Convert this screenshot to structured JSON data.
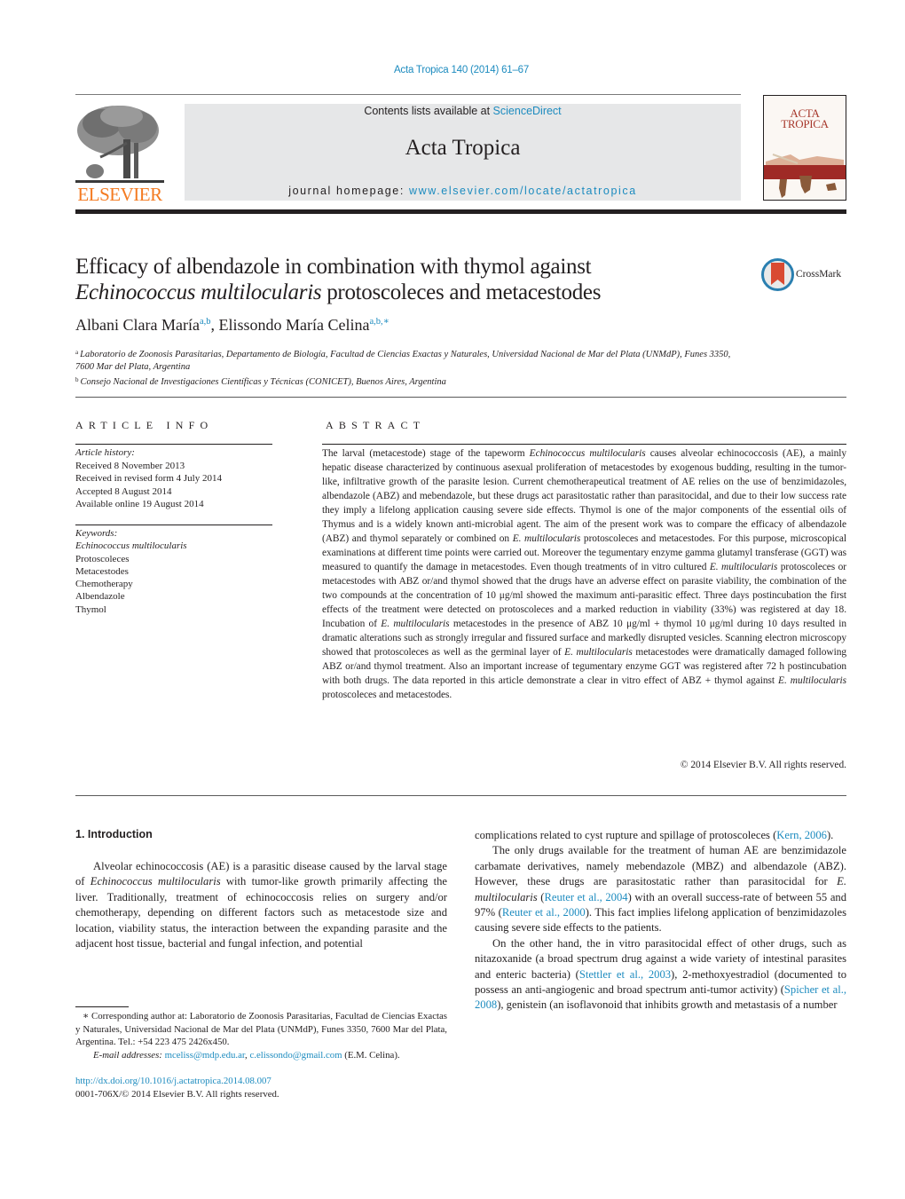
{
  "header": {
    "citation": "Acta Tropica 140 (2014) 61–67",
    "contents_prefix": "Contents lists available at ",
    "contents_link": "ScienceDirect",
    "journal_name": "Acta Tropica",
    "homepage_prefix": "journal homepage: ",
    "homepage_link": "www.elsevier.com/locate/actatropica",
    "publisher_logo_text": "ELSEVIER",
    "cover_title_line1": "ACTA",
    "cover_title_line2": "TROPICA",
    "crossmark_label": "CrossMark"
  },
  "article": {
    "title_line1": "Efficacy of albendazole in combination with thymol against",
    "title_line2_italic": "Echinococcus multilocularis",
    "title_line2_rest": " protoscoleces and metacestodes",
    "authors": [
      {
        "name": "Albani Clara María",
        "affil": "a,b"
      },
      {
        "name": "Elissondo María Celina",
        "affil": "a,b,∗"
      }
    ],
    "affiliations": [
      {
        "mark": "a",
        "text": "Laboratorio de Zoonosis Parasitarias, Departamento de Biología, Facultad de Ciencias Exactas y Naturales, Universidad Nacional de Mar del Plata (UNMdP), Funes 3350, 7600 Mar del Plata, Argentina"
      },
      {
        "mark": "b",
        "text": "Consejo Nacional de Investigaciones Científicas y Técnicas (CONICET), Buenos Aires, Argentina"
      }
    ]
  },
  "article_info": {
    "heading": "ARTICLE INFO",
    "history_label": "Article history:",
    "history": [
      "Received 8 November 2013",
      "Received in revised form 4 July 2014",
      "Accepted 8 August 2014",
      "Available online 19 August 2014"
    ],
    "keywords_label": "Keywords:",
    "keywords": [
      "Echinococcus multilocularis",
      "Protoscoleces",
      "Metacestodes",
      "Chemotherapy",
      "Albendazole",
      "Thymol"
    ]
  },
  "abstract": {
    "heading": "ABSTRACT",
    "segments": [
      {
        "t": "The larval (metacestode) stage of the tapeworm "
      },
      {
        "t": "Echinococcus multilocularis",
        "i": true
      },
      {
        "t": " causes alveolar echinococcosis (AE), a mainly hepatic disease characterized by continuous asexual proliferation of metacestodes by exogenous budding, resulting in the tumor-like, infiltrative growth of the parasite lesion. Current chemotherapeutical treatment of AE relies on the use of benzimidazoles, albendazole (ABZ) and mebendazole, but these drugs act parasitostatic rather than parasitocidal, and due to their low success rate they imply a lifelong application causing severe side effects. Thymol is one of the major components of the essential oils of Thymus and is a widely known anti-microbial agent. The aim of the present work was to compare the efficacy of albendazole (ABZ) and thymol separately or combined on "
      },
      {
        "t": "E. multilocularis",
        "i": true
      },
      {
        "t": " protoscoleces and metacestodes. For this purpose, microscopical examinations at different time points were carried out. Moreover the tegumentary enzyme gamma glutamyl transferase (GGT) was measured to quantify the damage in metacestodes. Even though treatments of in vitro cultured "
      },
      {
        "t": "E. multilocularis",
        "i": true
      },
      {
        "t": " protoscoleces or metacestodes with ABZ or/and thymol showed that the drugs have an adverse effect on parasite viability, the combination of the two compounds at the concentration of 10 μg/ml showed the maximum anti-parasitic effect. Three days postincubation the first effects of the treatment were detected on protoscoleces and a marked reduction in viability (33%) was registered at day 18. Incubation of "
      },
      {
        "t": "E. multilocularis",
        "i": true
      },
      {
        "t": " metacestodes in the presence of ABZ 10 μg/ml + thymol 10 μg/ml during 10 days resulted in dramatic alterations such as strongly irregular and fissured surface and markedly disrupted vesicles. Scanning electron microscopy showed that protoscoleces as well as the germinal layer of "
      },
      {
        "t": "E. multilocularis",
        "i": true
      },
      {
        "t": " metacestodes were dramatically damaged following ABZ or/and thymol treatment. Also an important increase of tegumentary enzyme GGT was registered after 72 h postincubation with both drugs. The data reported in this article demonstrate a clear in vitro effect of ABZ + thymol against "
      },
      {
        "t": "E. multilocularis",
        "i": true
      },
      {
        "t": " protoscoleces and metacestodes."
      }
    ],
    "copyright": "© 2014 Elsevier B.V. All rights reserved."
  },
  "body": {
    "section_title": "1.  Introduction",
    "left_paragraphs": [
      [
        {
          "t": "Alveolar echinococcosis (AE) is a parasitic disease caused by the larval stage of "
        },
        {
          "t": "Echinococcus multilocularis",
          "i": true
        },
        {
          "t": " with tumor-like growth primarily affecting the liver. Traditionally, treatment of echinococcosis relies on surgery and/or chemotherapy, depending on different factors such as metacestode size and location, viability status, the interaction between the expanding parasite and the adjacent host tissue, bacterial and fungal infection, and potential"
        }
      ]
    ],
    "right_paragraphs": [
      [
        {
          "t": "complications related to cyst rupture and spillage of protoscoleces ("
        },
        {
          "t": "Kern, 2006",
          "link": true
        },
        {
          "t": ")."
        }
      ],
      [
        {
          "t": "The only drugs available for the treatment of human AE are benzimidazole carbamate derivatives, namely mebendazole (MBZ) and albendazole (ABZ). However, these drugs are parasitostatic rather than parasitocidal for "
        },
        {
          "t": "E. multilocularis",
          "i": true
        },
        {
          "t": " ("
        },
        {
          "t": "Reuter et al., 2004",
          "link": true
        },
        {
          "t": ") with an overall success-rate of between 55 and 97% ("
        },
        {
          "t": "Reuter et al., 2000",
          "link": true
        },
        {
          "t": "). This fact implies lifelong application of benzimidazoles causing severe side effects to the patients."
        }
      ],
      [
        {
          "t": "On the other hand, the in vitro parasitocidal effect of other drugs, such as nitazoxanide (a broad spectrum drug against a wide variety of intestinal parasites and enteric bacteria) ("
        },
        {
          "t": "Stettler et al., 2003",
          "link": true
        },
        {
          "t": "), 2-methoxyestradiol (documented to possess an anti-angiogenic and broad spectrum anti-tumor activity) ("
        },
        {
          "t": "Spicher et al., 2008",
          "link": true
        },
        {
          "t": "), genistein (an isoflavonoid that inhibits growth and metastasis of a number"
        }
      ]
    ],
    "footnote": {
      "corresponding": "∗ Corresponding author at: Laboratorio de Zoonosis Parasitarias, Facultad de Ciencias Exactas y Naturales, Universidad Nacional de Mar del Plata (UNMdP), Funes 3350, 7600 Mar del Plata, Argentina. Tel.: +54 223 475 2426x450.",
      "email_label": "E-mail addresses:",
      "email1": "mceliss@mdp.edu.ar",
      "email2": "c.elissondo@gmail.com",
      "email_suffix": " (E.M. Celina)."
    },
    "doi": "http://dx.doi.org/10.1016/j.actatropica.2014.08.007",
    "issn_line": "0001-706X/© 2014 Elsevier B.V. All rights reserved."
  },
  "colors": {
    "link": "#1c8bbf",
    "elsevier_orange": "#f47a20",
    "header_box": "#e6e7e8",
    "cover_red": "#9f2a26"
  }
}
